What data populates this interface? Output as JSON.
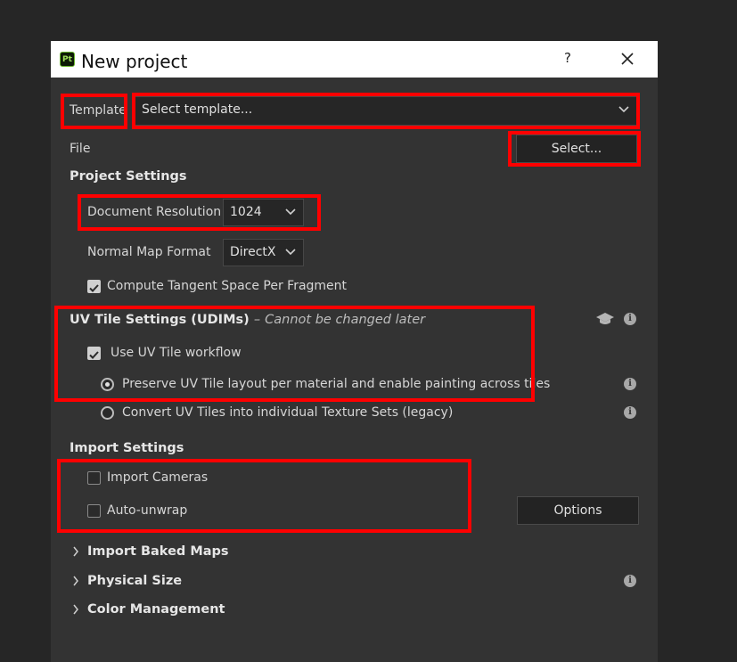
{
  "dialog": {
    "title": "New project",
    "app_icon_text": "Pt",
    "help_label": "?"
  },
  "template": {
    "label": "Template",
    "placeholder": "Select template..."
  },
  "file": {
    "label": "File",
    "select_label": "Select..."
  },
  "project_settings": {
    "heading": "Project Settings",
    "document_resolution_label": "Document Resolution",
    "document_resolution_value": "1024",
    "normal_map_format_label": "Normal Map Format",
    "normal_map_format_value": "DirectX",
    "compute_tangent_label": "Compute Tangent Space Per Fragment",
    "compute_tangent_checked": true
  },
  "uv_tile_settings": {
    "heading": "UV Tile Settings (UDIMs)",
    "dash": "–",
    "note": "Cannot be changed later",
    "use_uv_tile_label": "Use UV Tile workflow",
    "use_uv_tile_checked": true,
    "option_preserve": "Preserve UV Tile layout per material and enable painting across tiles",
    "option_convert": "Convert UV Tiles into individual Texture Sets (legacy)",
    "selected_option": "preserve"
  },
  "import_settings": {
    "heading": "Import Settings",
    "import_cameras_label": "Import Cameras",
    "import_cameras_checked": false,
    "auto_unwrap_label": "Auto-unwrap",
    "auto_unwrap_checked": false,
    "options_label": "Options"
  },
  "sections": [
    {
      "label": "Import Baked Maps"
    },
    {
      "label": "Physical Size"
    },
    {
      "label": "Color Management"
    }
  ],
  "colors": {
    "dialog_bg": "#333333",
    "highlight": "#ff0000",
    "title_bar": "#ffffff"
  }
}
